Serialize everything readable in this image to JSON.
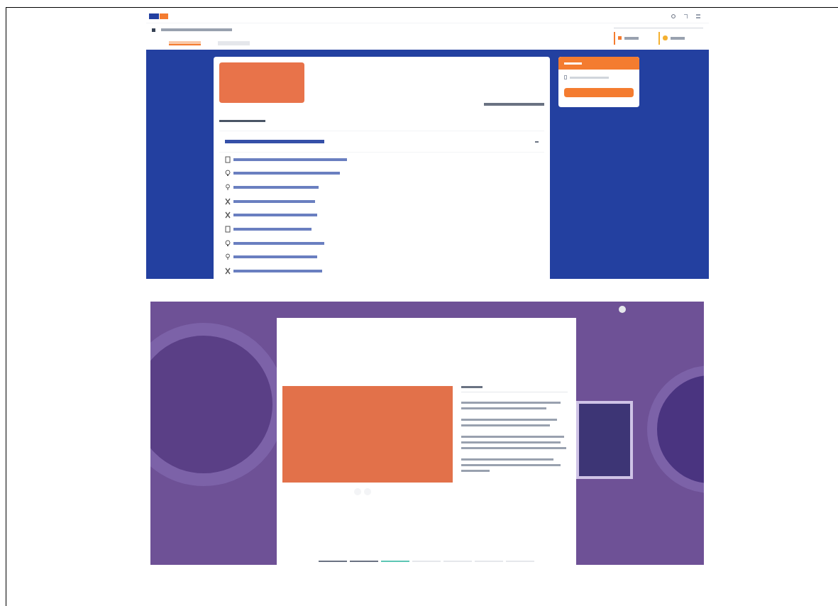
{
  "course_page": {
    "tabs": [
      {
        "selected": true
      },
      {
        "selected": false
      }
    ],
    "module": {
      "expanded": true
    },
    "lessons": [
      {
        "kind": "doc"
      },
      {
        "kind": "bulb"
      },
      {
        "kind": "pin"
      },
      {
        "kind": "tools"
      },
      {
        "kind": "tools"
      },
      {
        "kind": "doc"
      },
      {
        "kind": "bulb"
      },
      {
        "kind": "pin"
      },
      {
        "kind": "tools"
      }
    ]
  },
  "lesson_viewer": {
    "progress_segments": [
      {
        "completed": true,
        "selected": false
      },
      {
        "completed": true,
        "selected": false
      },
      {
        "completed": false,
        "selected": true
      },
      {
        "completed": false,
        "selected": false
      },
      {
        "completed": false,
        "selected": false
      },
      {
        "completed": false,
        "selected": false
      },
      {
        "completed": false,
        "selected": false
      }
    ]
  }
}
